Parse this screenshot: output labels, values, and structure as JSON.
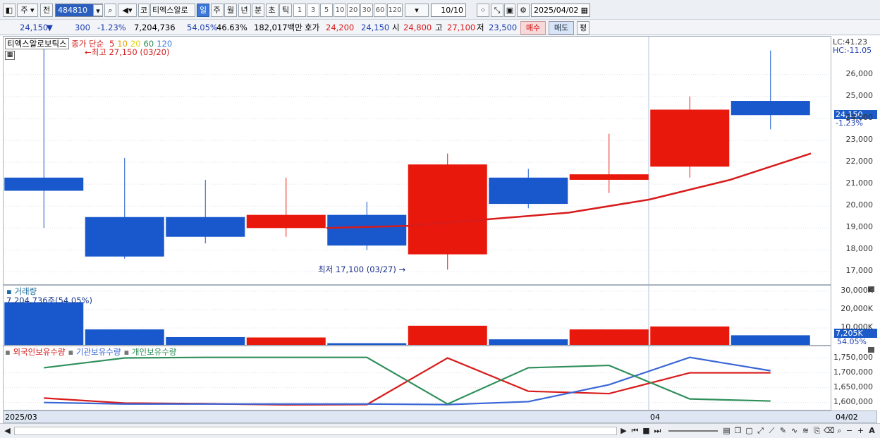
{
  "toolbar": {
    "market": "주",
    "prev": "전",
    "code": "484810",
    "stock_prefix": "코",
    "stock_name": "티엑스알로",
    "periods": [
      "일",
      "주",
      "월",
      "년",
      "분",
      "초",
      "틱"
    ],
    "selected_period": "일",
    "intervals": [
      "1",
      "3",
      "5",
      "10",
      "20",
      "30",
      "60",
      "120"
    ],
    "count": "10/10",
    "date": "2025/04/02"
  },
  "quote": {
    "price": "24,150",
    "change_arrow": "▼",
    "change": "300",
    "change_pct": "-1.23%",
    "volume": "7,204,736",
    "vol_ratio": "54.05%",
    "turnover": "46.63%",
    "amount": "182,017백만",
    "ask_label": "호가",
    "ask": "24,200",
    "bid": "24,150",
    "open_label": "시",
    "open": "24,800",
    "high_label": "고",
    "high": "27,100",
    "low_label": "저",
    "low": "23,500",
    "buy_button": "매수",
    "sell_button": "매도",
    "eval_button": "평"
  },
  "price_panel": {
    "stock_label": "티엑스알로보틱스",
    "ma_label_prefix": "종가 단순",
    "ma_periods": [
      "5",
      "10",
      "20",
      "60",
      "120"
    ],
    "ma_colors": [
      "#d81b1b",
      "#e0a000",
      "#e0d000",
      "#2e8b57",
      "#3a7bd5"
    ],
    "high_marker": "최고 27,150 (03/20)",
    "low_marker": "최저 17,100 (03/27)",
    "lc": "LC:41.23",
    "hc": "HC:-11.05",
    "price_tag": "24,150",
    "pct_tag": "-1.23%"
  },
  "volume_panel": {
    "title": "거래량",
    "info": "7,204,736주(54.05%)",
    "tag": "7,205K",
    "tag_pct": "54.05%"
  },
  "holder_panel": {
    "legend": [
      "외국인보유수량",
      "기관보유수량",
      "개인보유수량"
    ]
  },
  "xaxis": {
    "labels": [
      "2025/03",
      "04",
      "04/02"
    ]
  },
  "colors": {
    "up": "#e8190c",
    "down": "#1858cc",
    "ma5": "#d81b1b",
    "foreign": "#d81b1b",
    "institution": "#3a66d6",
    "individual": "#2f8f5b"
  },
  "chart_data": [
    {
      "type": "candlestick",
      "title": "",
      "ylim": [
        16500,
        27600
      ],
      "yticks": [
        "17,000",
        "18,000",
        "19,000",
        "20,000",
        "21,000",
        "22,000",
        "23,000",
        "24,000",
        "25,000",
        "26,000"
      ],
      "yvalues": [
        17000,
        18000,
        19000,
        20000,
        21000,
        22000,
        23000,
        24000,
        25000,
        26000
      ],
      "candles": [
        {
          "open": 21300,
          "close": 20700,
          "high": 27150,
          "low": 19000
        },
        {
          "open": 19500,
          "close": 17700,
          "high": 22200,
          "low": 17600
        },
        {
          "open": 19500,
          "close": 18600,
          "high": 21200,
          "low": 18300
        },
        {
          "open": 19000,
          "close": 19600,
          "high": 21300,
          "low": 18600
        },
        {
          "open": 19600,
          "close": 18200,
          "high": 20200,
          "low": 18000
        },
        {
          "open": 17800,
          "close": 21900,
          "high": 22400,
          "low": 17100
        },
        {
          "open": 21300,
          "close": 20100,
          "high": 21700,
          "low": 19900
        },
        {
          "open": 21200,
          "close": 21450,
          "high": 23300,
          "low": 20600
        },
        {
          "open": 21800,
          "close": 24400,
          "high": 25000,
          "low": 21300
        },
        {
          "open": 24800,
          "close": 24150,
          "high": 27100,
          "low": 23500
        }
      ],
      "ma5": [
        null,
        null,
        null,
        null,
        19000,
        19100,
        19400,
        19700,
        20300,
        21200,
        22400
      ]
    },
    {
      "type": "bar",
      "title": "거래량",
      "ylim": [
        0,
        33000
      ],
      "yticks": [
        "10,000K",
        "20,000K",
        "30,000K"
      ],
      "yvalues": [
        10000,
        20000,
        30000
      ],
      "values": [
        24000,
        9200,
        5000,
        4800,
        1700,
        11200,
        3800,
        9200,
        10800,
        6000
      ],
      "up": [
        false,
        false,
        false,
        true,
        false,
        true,
        false,
        true,
        true,
        false
      ]
    },
    {
      "type": "line",
      "title": "",
      "ylim": [
        1585000,
        1775000
      ],
      "yticks": [
        "1,600,000",
        "1,650,000",
        "1,700,000",
        "1,750,000"
      ],
      "yvalues": [
        1600000,
        1650000,
        1700000,
        1750000
      ],
      "series": [
        {
          "name": "외국인보유수량",
          "values": [
            1615000,
            1598000,
            1596000,
            1592000,
            1593000,
            1750000,
            1638000,
            1630000,
            1700000,
            1700000
          ]
        },
        {
          "name": "기관보유수량",
          "values": [
            1600000,
            1595000,
            1595000,
            1595000,
            1595000,
            1593000,
            1603000,
            1660000,
            1752000,
            1707000
          ]
        },
        {
          "name": "개인보유수량",
          "values": [
            1717000,
            1750000,
            1752000,
            1752000,
            1752000,
            1595000,
            1717000,
            1725000,
            1612000,
            1605000
          ]
        }
      ]
    }
  ]
}
